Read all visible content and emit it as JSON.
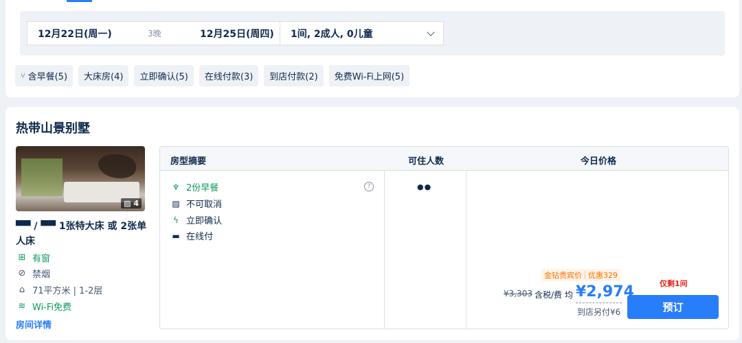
{
  "search": {
    "checkin": "12月22日(周一)",
    "nights": "3晚",
    "checkout": "12月25日(周四)",
    "guests": "1间, 2成人, 0儿童"
  },
  "filters": [
    {
      "label": "含早餐(5)",
      "icon": "breakfast-icon"
    },
    {
      "label": "大床房(4)"
    },
    {
      "label": "立即确认(5)"
    },
    {
      "label": "在线付款(3)"
    },
    {
      "label": "到店付款(2)"
    },
    {
      "label": "免费Wi-Fi上网(5)"
    }
  ],
  "room": {
    "title": "热带山景别墅",
    "photo_count": "4",
    "bed_icons": "/",
    "bed_desc": "1张特大床 或 2张单人床",
    "features": [
      {
        "icon": "window-icon",
        "label": "有窗"
      },
      {
        "icon": "no-smoking-icon",
        "label": "禁烟"
      },
      {
        "icon": "area-icon",
        "label": "71平方米 | 1-2层"
      },
      {
        "icon": "wifi-icon",
        "label": "Wi-Fi免费"
      }
    ],
    "detail_link": "房间详情"
  },
  "table": {
    "headers": {
      "summary": "房型摘要",
      "occupancy": "可住人数",
      "price": "今日价格"
    },
    "perks": [
      {
        "icon": "utensils-icon",
        "label": "2份早餐"
      },
      {
        "icon": "no-cancel-icon",
        "label": "不可取消"
      },
      {
        "icon": "lightning-icon",
        "label": "立即确认"
      },
      {
        "icon": "card-icon",
        "label": "在线付"
      }
    ]
  },
  "pricing": {
    "promo_tag": "金钻贵宾价",
    "discount": "优惠329",
    "original": "¥3,303",
    "tax_label": "含税/费 均",
    "price": "¥2,974",
    "pay_at_hotel": "到店另付¥6",
    "availability": "仅剩1间",
    "book_label": "预订"
  },
  "colors": {
    "accent": "#287dfa",
    "green": "#0a9b5e",
    "orange": "#ff6f00",
    "red": "#e1251b"
  }
}
